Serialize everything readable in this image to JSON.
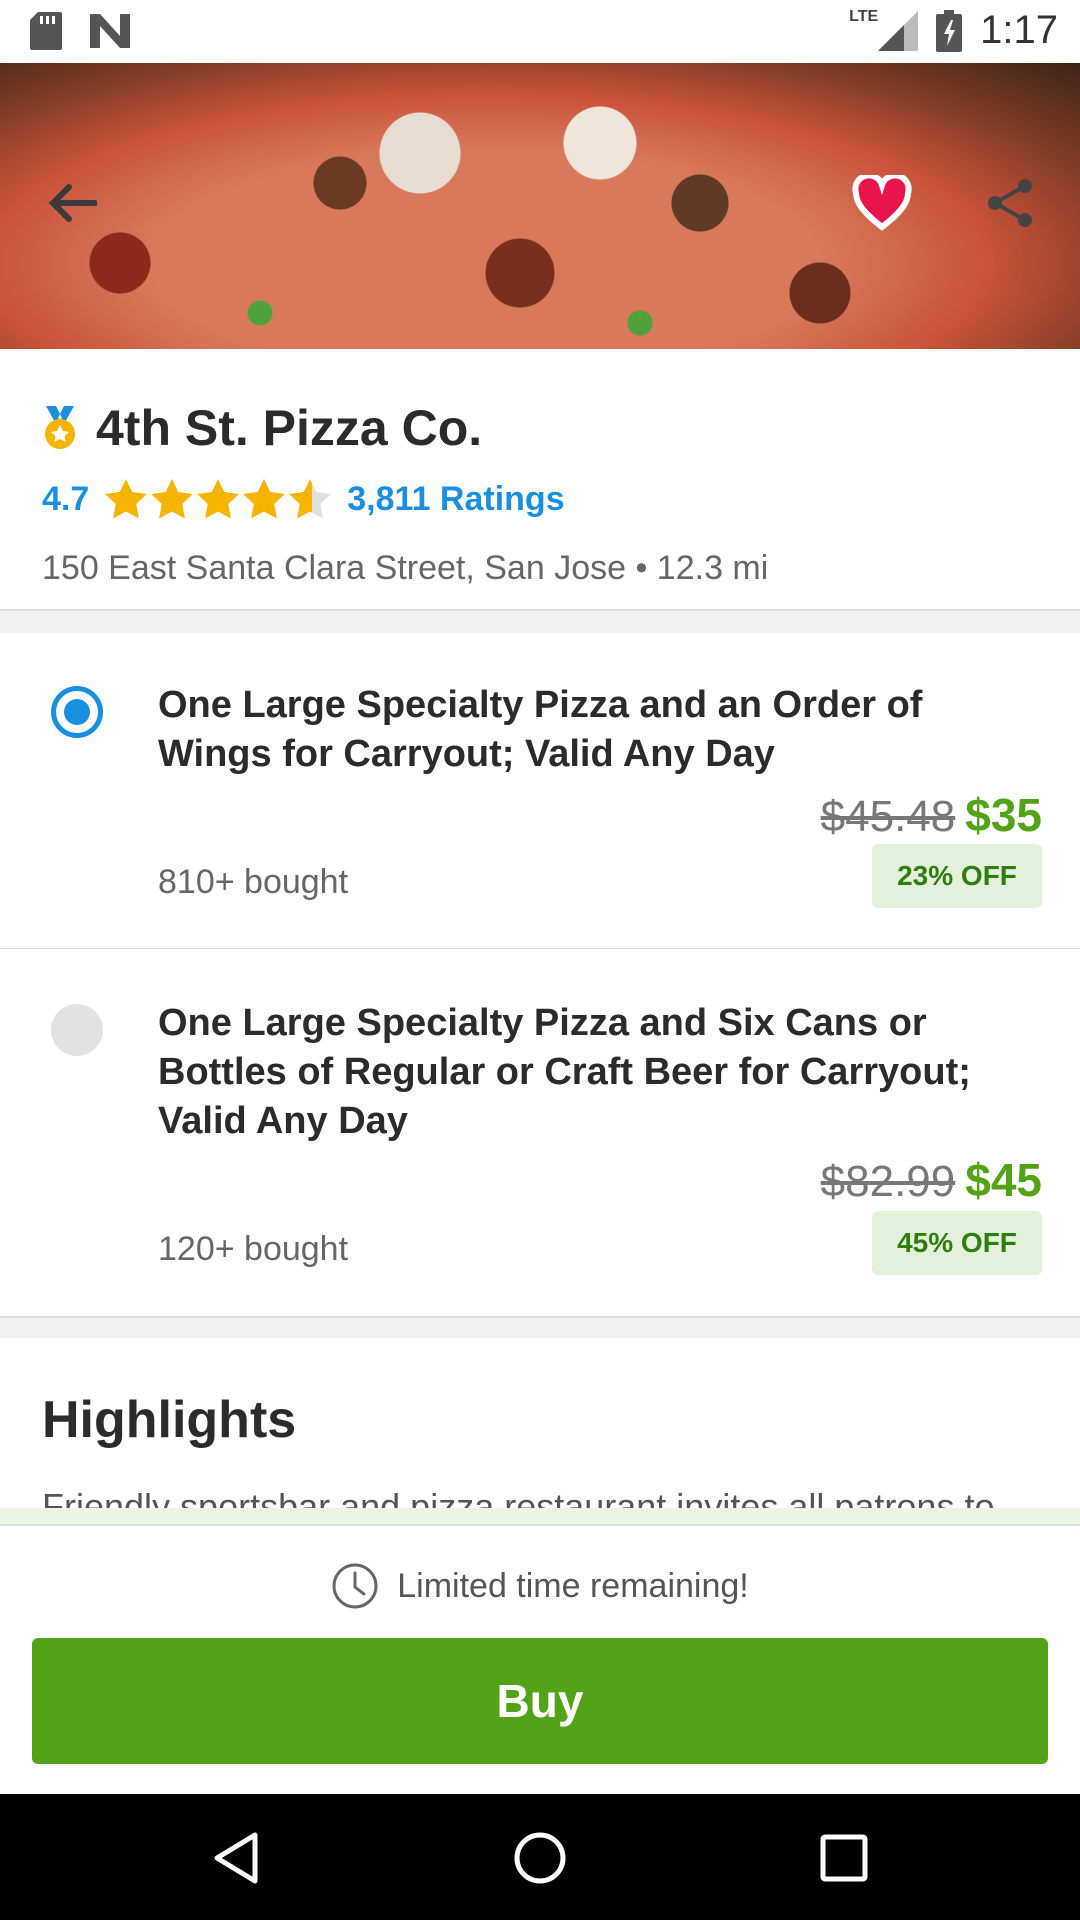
{
  "status_bar": {
    "network": "LTE",
    "time": "1:17",
    "icons": [
      "sd-card-icon",
      "n-icon",
      "signal-icon",
      "battery-icon"
    ]
  },
  "hero": {
    "icons": [
      "back-arrow-icon",
      "heart-icon",
      "share-icon"
    ],
    "favorite_color": "#e8144a"
  },
  "merchant": {
    "name": "4th St. Pizza Co.",
    "rating": "4.7",
    "stars": 4.7,
    "ratings_count": "3,811 Ratings",
    "address": "150 East Santa Clara Street, San Jose • 12.3 mi"
  },
  "options": [
    {
      "title": "One Large Specialty Pizza and an Order of Wings for Carryout; Valid Any Day",
      "original_price": "$45.48",
      "price": "$35",
      "bought": "810+ bought",
      "discount": "23% OFF",
      "selected": true
    },
    {
      "title": "One Large Specialty Pizza and Six Cans or Bottles of Regular or Craft Beer for Carryout; Valid Any Day",
      "original_price": "$82.99",
      "price": "$45",
      "bought": "120+ bought",
      "discount": "45% OFF",
      "selected": false
    }
  ],
  "highlights": {
    "heading": "Highlights",
    "text": "Friendly sportsbar and pizza restaurant invites all patrons to"
  },
  "footer": {
    "limited_text": "Limited time remaining!",
    "buy_label": "Buy"
  },
  "colors": {
    "accent_blue": "#1a8fe0",
    "accent_green": "#53a318",
    "star_gold": "#f4b400"
  }
}
